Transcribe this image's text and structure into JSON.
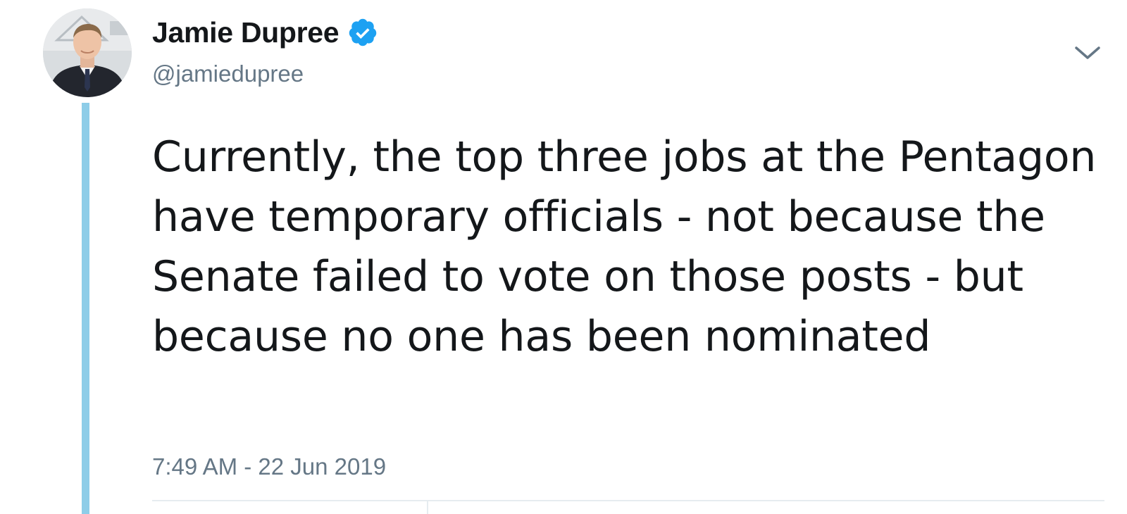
{
  "tweet": {
    "author": {
      "display_name": "Jamie Dupree",
      "handle": "@jamiedupree",
      "verified": true
    },
    "text": "Currently, the top three jobs at the Pentagon have temporary officials - not because the Senate failed to vote on those posts - but because no one has been nominated",
    "timestamp": "7:49 AM - 22 Jun 2019"
  },
  "icons": {
    "verified": "verified-badge-icon",
    "menu": "chevron-down-icon"
  },
  "colors": {
    "accent": "#1da1f2",
    "thread_line": "#8ecde8",
    "text": "#14171a",
    "secondary_text": "#657786"
  }
}
